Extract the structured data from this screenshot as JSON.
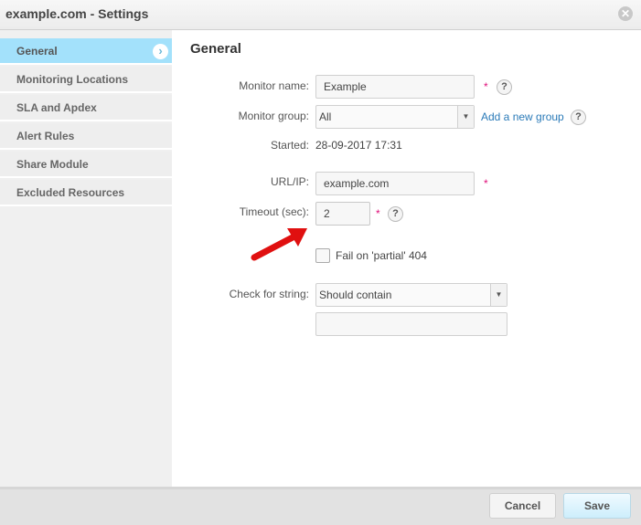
{
  "window": {
    "title": "example.com - Settings",
    "close_icon": "close-icon"
  },
  "sidebar": {
    "items": [
      {
        "label": "General",
        "active": true
      },
      {
        "label": "Monitoring Locations"
      },
      {
        "label": "SLA and Apdex"
      },
      {
        "label": "Alert Rules"
      },
      {
        "label": "Share Module"
      },
      {
        "label": "Excluded Resources"
      }
    ]
  },
  "main": {
    "heading": "General",
    "monitor_name": {
      "label": "Monitor name:",
      "value": "Example",
      "required": "*"
    },
    "monitor_group": {
      "label": "Monitor group:",
      "value": "All",
      "add_link": "Add a new group"
    },
    "started": {
      "label": "Started:",
      "value": "28-09-2017 17:31"
    },
    "url": {
      "label": "URL/IP:",
      "value": "example.com",
      "required": "*"
    },
    "timeout": {
      "label": "Timeout (sec):",
      "value": "2",
      "required": "*"
    },
    "fail_partial": {
      "label": "Fail on 'partial' 404",
      "checked": false
    },
    "check_string": {
      "label": "Check for string:",
      "value": "Should contain",
      "text": ""
    },
    "help": "?"
  },
  "footer": {
    "cancel": "Cancel",
    "save": "Save"
  },
  "colors": {
    "accent": "#a3e1fb",
    "required": "#e0107a",
    "link": "#2a7ab8",
    "arrow": "#e01010"
  }
}
